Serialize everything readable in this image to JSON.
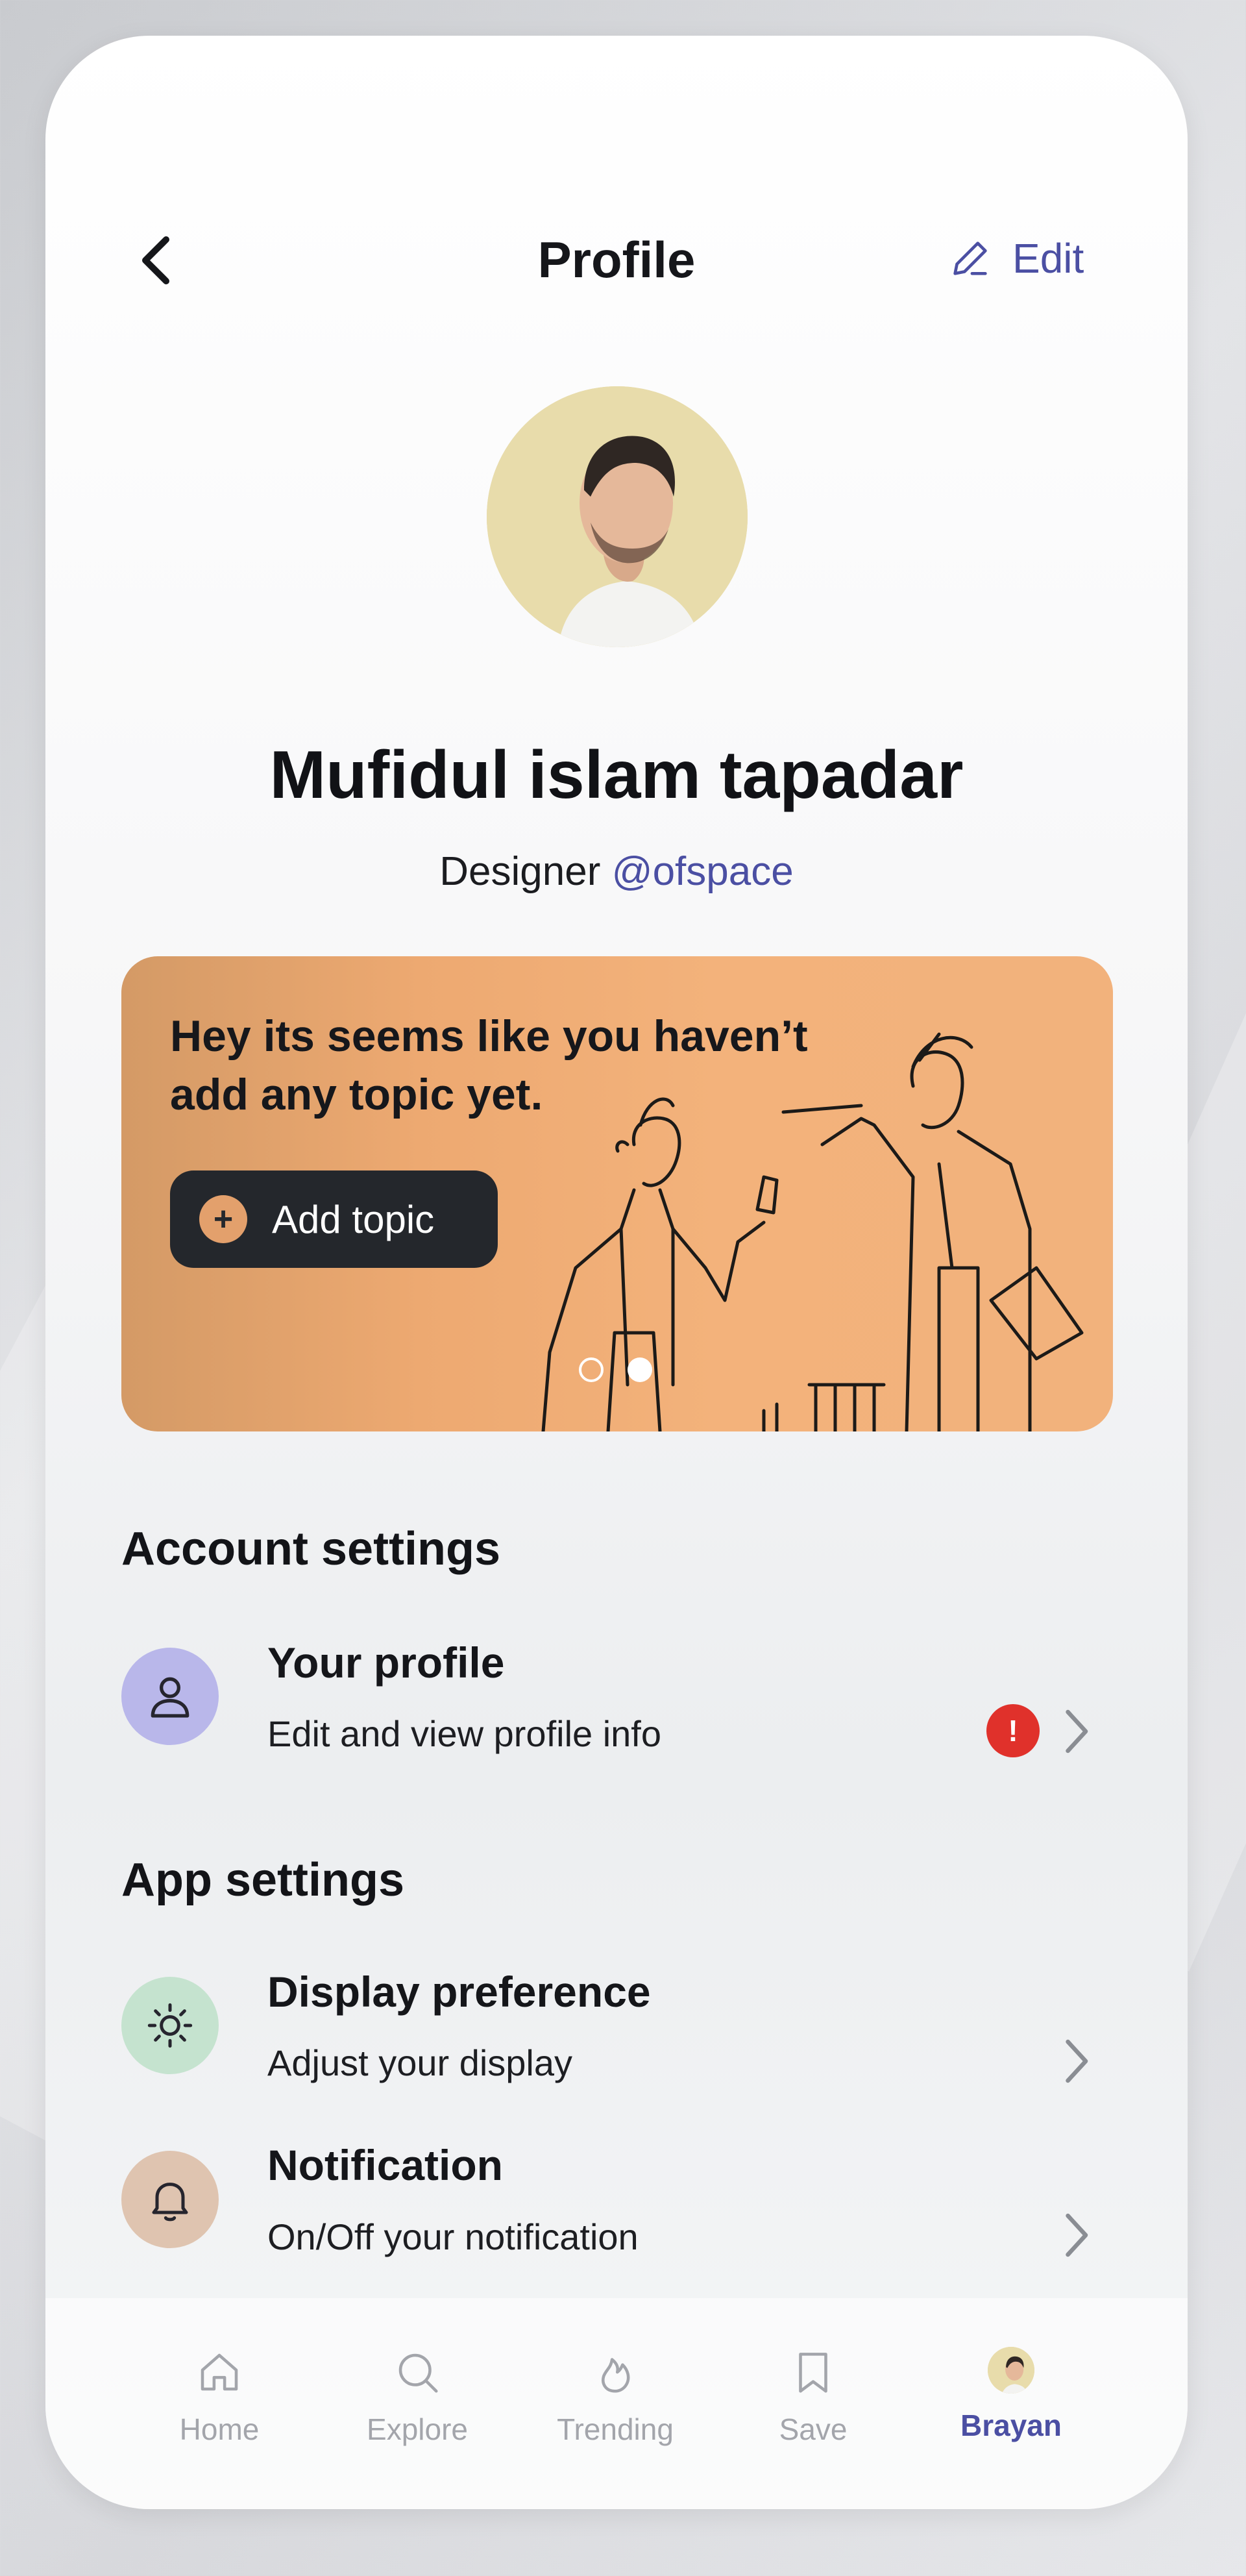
{
  "header": {
    "title": "Profile",
    "edit_label": "Edit"
  },
  "profile": {
    "name": "Mufidul islam tapadar",
    "role": "Designer",
    "handle": "@ofspace"
  },
  "banner": {
    "message": "Hey its seems like you haven’t add any topic yet.",
    "button_label": "Add topic",
    "active_slide": 2,
    "total_slides": 2
  },
  "account_settings": {
    "title": "Account settings",
    "items": [
      {
        "title": "Your profile",
        "subtitle": "Edit and view profile info",
        "icon": "user-icon",
        "alert": "!"
      }
    ]
  },
  "app_settings": {
    "title": "App settings",
    "items": [
      {
        "title": "Display preference",
        "subtitle": "Adjust your display",
        "icon": "sun-icon"
      },
      {
        "title": "Notification",
        "subtitle": "On/Off your notification",
        "icon": "bell-icon"
      }
    ]
  },
  "tabbar": {
    "items": [
      {
        "label": "Home",
        "icon": "home-icon"
      },
      {
        "label": "Explore",
        "icon": "search-icon"
      },
      {
        "label": "Trending",
        "icon": "flame-icon"
      },
      {
        "label": "Save",
        "icon": "bookmark-icon"
      },
      {
        "label": "Brayan",
        "icon": "avatar",
        "active": true
      }
    ]
  },
  "colors": {
    "accent": "#4b4fa3",
    "banner": "#f2b27c",
    "alert": "#e0312b",
    "profile_icon_bg": "#b9b7ea",
    "display_icon_bg": "#c5e3cf",
    "notification_icon_bg": "#dfc4b0"
  }
}
